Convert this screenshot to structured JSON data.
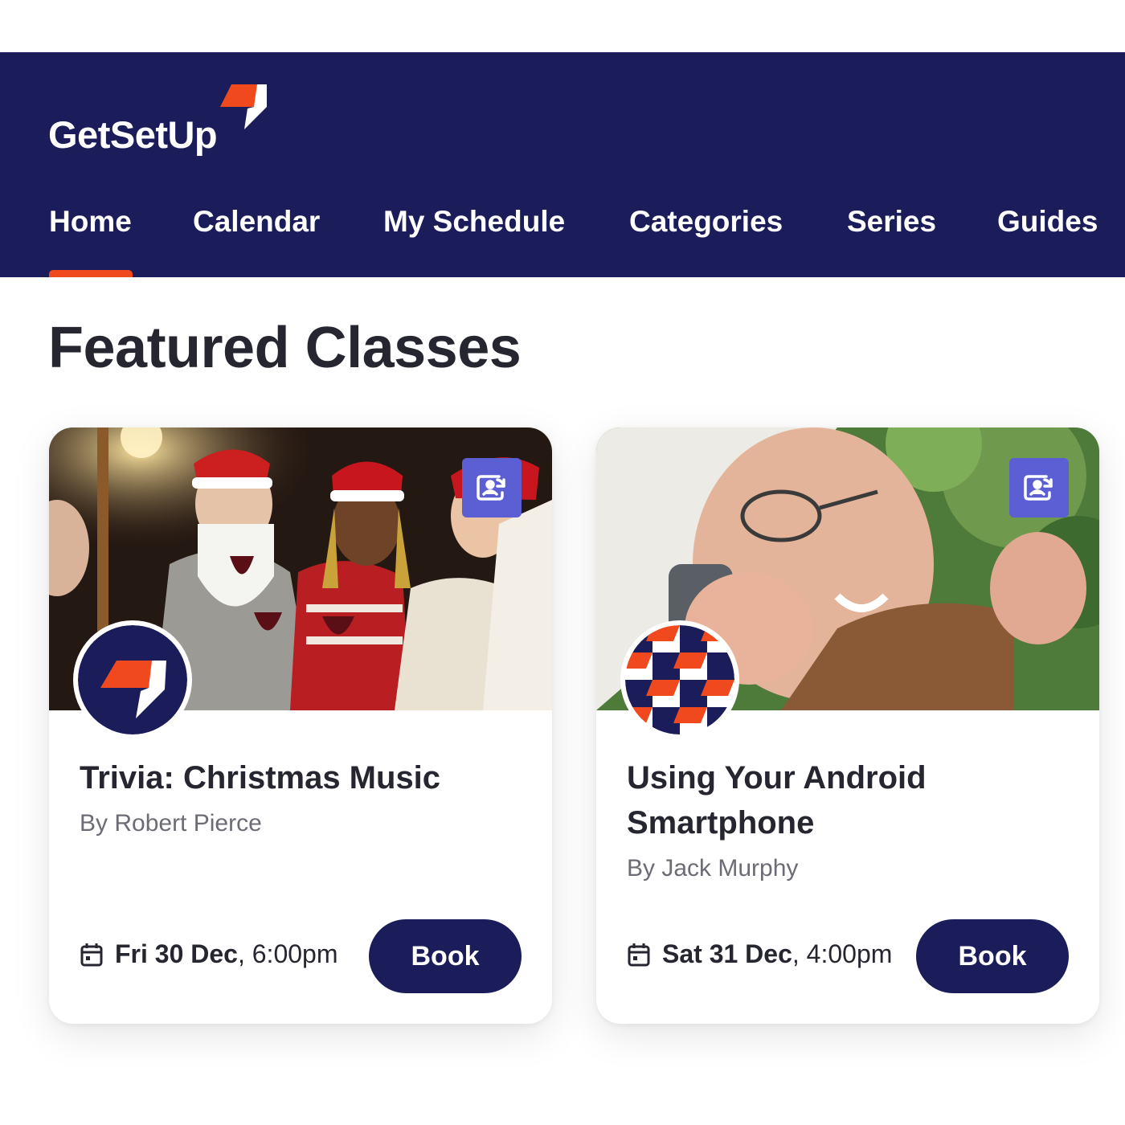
{
  "app": {
    "logo_text": "GetSetUp",
    "colors": {
      "header_bg": "#1b1c5a",
      "accent": "#f0491d",
      "badge": "#5b5fd3",
      "text_dark": "#262630"
    }
  },
  "nav": {
    "items": [
      {
        "label": "Home",
        "active": true
      },
      {
        "label": "Calendar",
        "active": false
      },
      {
        "label": "My Schedule",
        "active": false
      },
      {
        "label": "Categories",
        "active": false
      },
      {
        "label": "Series",
        "active": false
      },
      {
        "label": "Guides",
        "active": false
      }
    ]
  },
  "main": {
    "section_title": "Featured Classes",
    "cards": [
      {
        "title": "Trivia: Christmas Music",
        "author": "By Robert Pierce",
        "date_day": "Fri 30 Dec",
        "date_time": ", 6:00pm",
        "button_label": "Book",
        "badge_icon": "replay-icon",
        "avatar_icon": "getsetup-logo-icon"
      },
      {
        "title": "Using Your Android Smartphone",
        "author": "By Jack Murphy",
        "date_day": "Sat 31 Dec",
        "date_time": ", 4:00pm",
        "button_label": "Book",
        "badge_icon": "replay-icon",
        "avatar_icon": "checker-pattern-icon"
      }
    ]
  }
}
